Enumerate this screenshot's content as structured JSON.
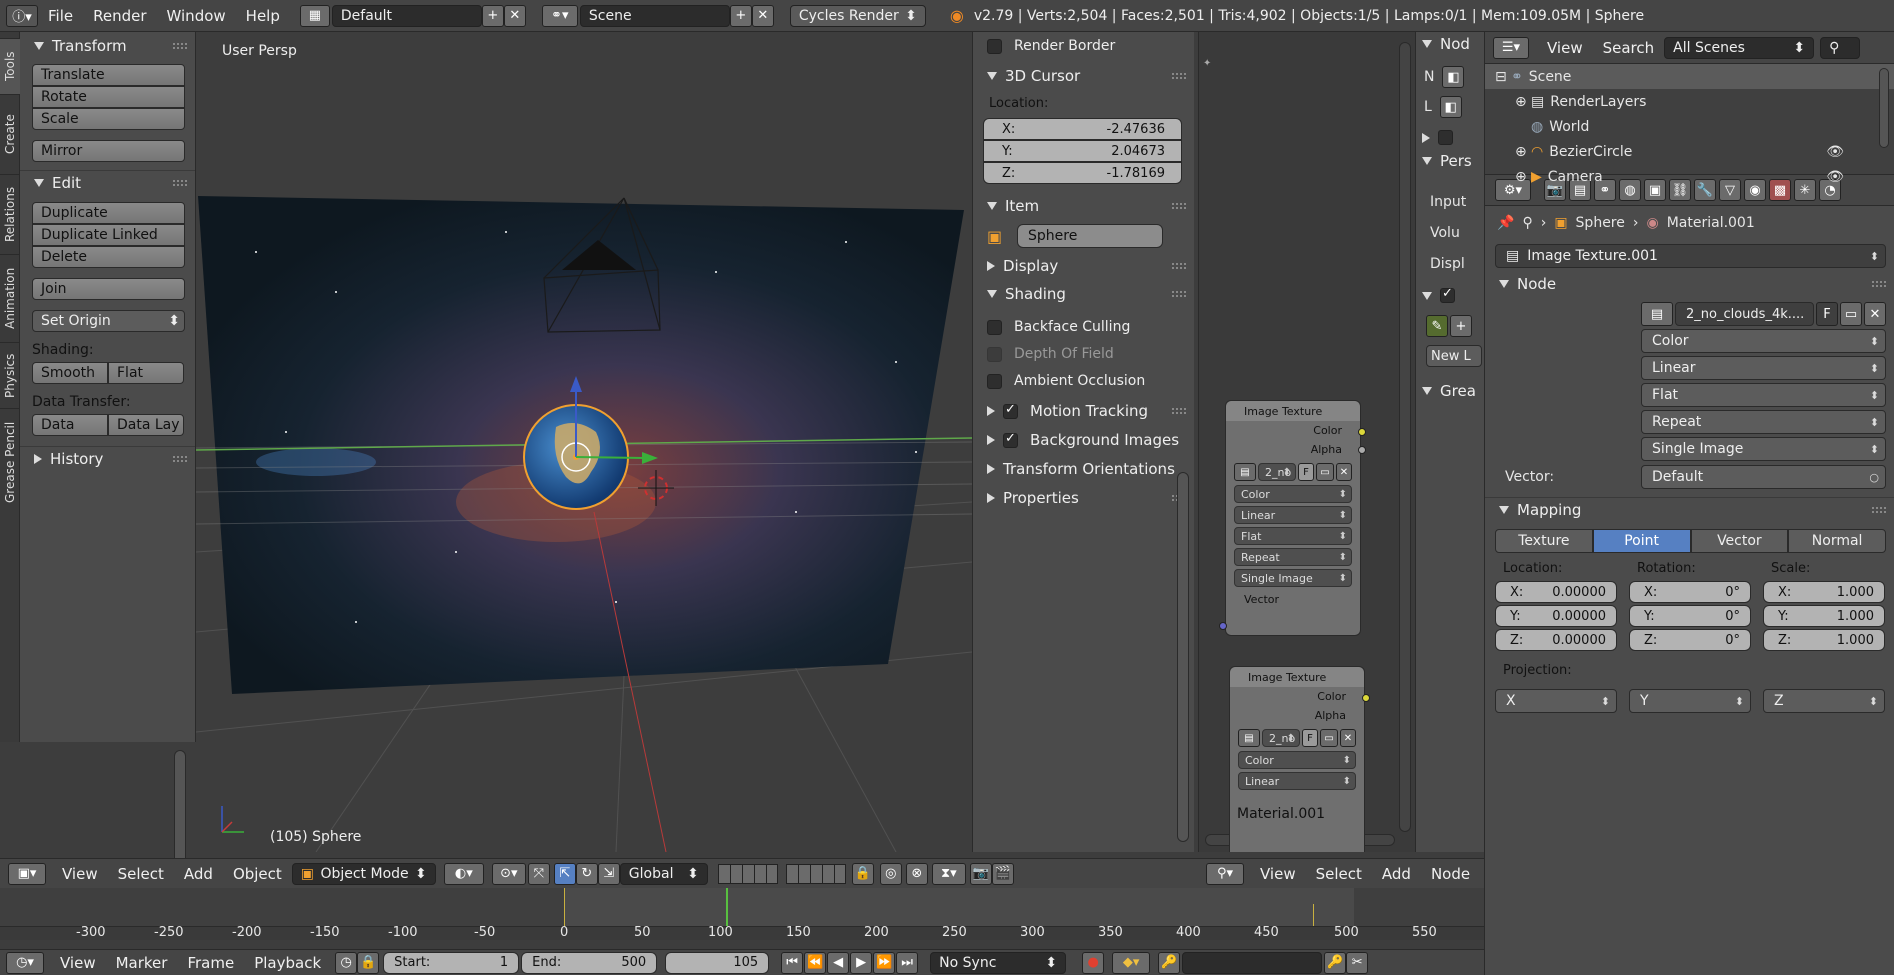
{
  "topbar": {
    "info_icon": "info-icon",
    "menus": [
      "File",
      "Render",
      "Window",
      "Help"
    ],
    "screen_layout": "Default",
    "scene": "Scene",
    "engine": "Cycles Render",
    "stats": "v2.79 | Verts:2,504 | Faces:2,501 | Tris:4,902 | Objects:1/5 | Lamps:0/1 | Mem:109.05M | Sphere"
  },
  "vtabs": [
    "Tools",
    "Create",
    "Relations",
    "Animation",
    "Physics",
    "Grease Pencil"
  ],
  "toolshelf": {
    "transform_title": "Transform",
    "translate": "Translate",
    "rotate": "Rotate",
    "scale": "Scale",
    "mirror": "Mirror",
    "edit_title": "Edit",
    "duplicate": "Duplicate",
    "duplicate_linked": "Duplicate Linked",
    "delete": "Delete",
    "join": "Join",
    "set_origin": "Set Origin",
    "shading_label": "Shading:",
    "smooth": "Smooth",
    "flat": "Flat",
    "data_transfer_label": "Data Transfer:",
    "data": "Data",
    "data_lay": "Data Lay",
    "history": "History"
  },
  "viewport": {
    "persp_label": "User Persp",
    "object_label": "(105) Sphere"
  },
  "npanel": {
    "render_border": "Render Border",
    "cursor_title": "3D Cursor",
    "location_label": "Location:",
    "x_label": "X:",
    "x_value": "-2.47636",
    "y_label": "Y:",
    "y_value": "2.04673",
    "z_label": "Z:",
    "z_value": "-1.78169",
    "item_title": "Item",
    "item_name": "Sphere",
    "display_title": "Display",
    "shading_title": "Shading",
    "backface": "Backface Culling",
    "dof": "Depth Of Field",
    "ao": "Ambient Occlusion",
    "motion_tracking": "Motion Tracking",
    "background_images": "Background Images",
    "transform_orient": "Transform Orientations",
    "properties": "Properties"
  },
  "node_editor": {
    "side_labels": [
      "N",
      "L"
    ],
    "node1": {
      "title": "Image Texture",
      "out_color": "Color",
      "out_alpha": "Alpha",
      "image": "2_no",
      "f": "F",
      "opts": [
        "Color",
        "Linear",
        "Flat",
        "Repeat",
        "Single Image"
      ],
      "in_vector": "Vector"
    },
    "node2": {
      "title": "Image Texture",
      "out_color": "Color",
      "out_alpha": "Alpha",
      "image": "2_no",
      "f": "F",
      "opts": [
        "Color",
        "Linear"
      ]
    },
    "material_label": "Material.001",
    "partial_panel": [
      "Nod",
      "Pers",
      "Input",
      "Volu",
      "Displ",
      "Grea"
    ],
    "new_label": "New L"
  },
  "outliner": {
    "view": "View",
    "search": "Search",
    "filter": "All Scenes",
    "rows": [
      "Scene",
      "RenderLayers",
      "World",
      "BezierCircle",
      "Camera"
    ]
  },
  "props": {
    "breadcrumb_obj": "Sphere",
    "breadcrumb_mat": "Material.001",
    "texture_node": "Image Texture.001",
    "node_title": "Node",
    "image_name": "2_no_clouds_4k....",
    "f": "F",
    "color": "Color",
    "linear": "Linear",
    "flat": "Flat",
    "repeat": "Repeat",
    "single_image": "Single Image",
    "vector_label": "Vector:",
    "vector_value": "Default",
    "mapping_title": "Mapping",
    "tabs": [
      "Texture",
      "Point",
      "Vector",
      "Normal"
    ],
    "location_label": "Location:",
    "rotation_label": "Rotation:",
    "scale_label": "Scale:",
    "loc": [
      "0.00000",
      "0.00000",
      "0.00000"
    ],
    "rot": [
      "0°",
      "0°",
      "0°"
    ],
    "scl": [
      "1.000",
      "1.000",
      "1.000"
    ],
    "axis_labels": [
      "X:",
      "Y:",
      "Z:"
    ],
    "projection_label": "Projection:",
    "proj": [
      "X",
      "Y",
      "Z"
    ]
  },
  "viewport_header": {
    "view": "View",
    "select": "Select",
    "add": "Add",
    "object": "Object",
    "mode": "Object Mode",
    "orientation": "Global"
  },
  "node_header": {
    "view": "View",
    "select": "Select",
    "add": "Add",
    "node": "Node"
  },
  "timeline": {
    "ticks": [
      "-300",
      "-250",
      "-200",
      "-150",
      "-100",
      "-50",
      "0",
      "50",
      "100",
      "150",
      "200",
      "250",
      "300",
      "350",
      "400",
      "450",
      "500",
      "550"
    ]
  },
  "bottom": {
    "view": "View",
    "marker": "Marker",
    "frame": "Frame",
    "playback": "Playback",
    "start_label": "Start:",
    "start": "1",
    "end_label": "End:",
    "end": "500",
    "current": "105",
    "sync": "No Sync"
  },
  "colors": {
    "accent": "#5680c2",
    "background": "#3d3d3d",
    "panel": "#4b4b4b"
  }
}
